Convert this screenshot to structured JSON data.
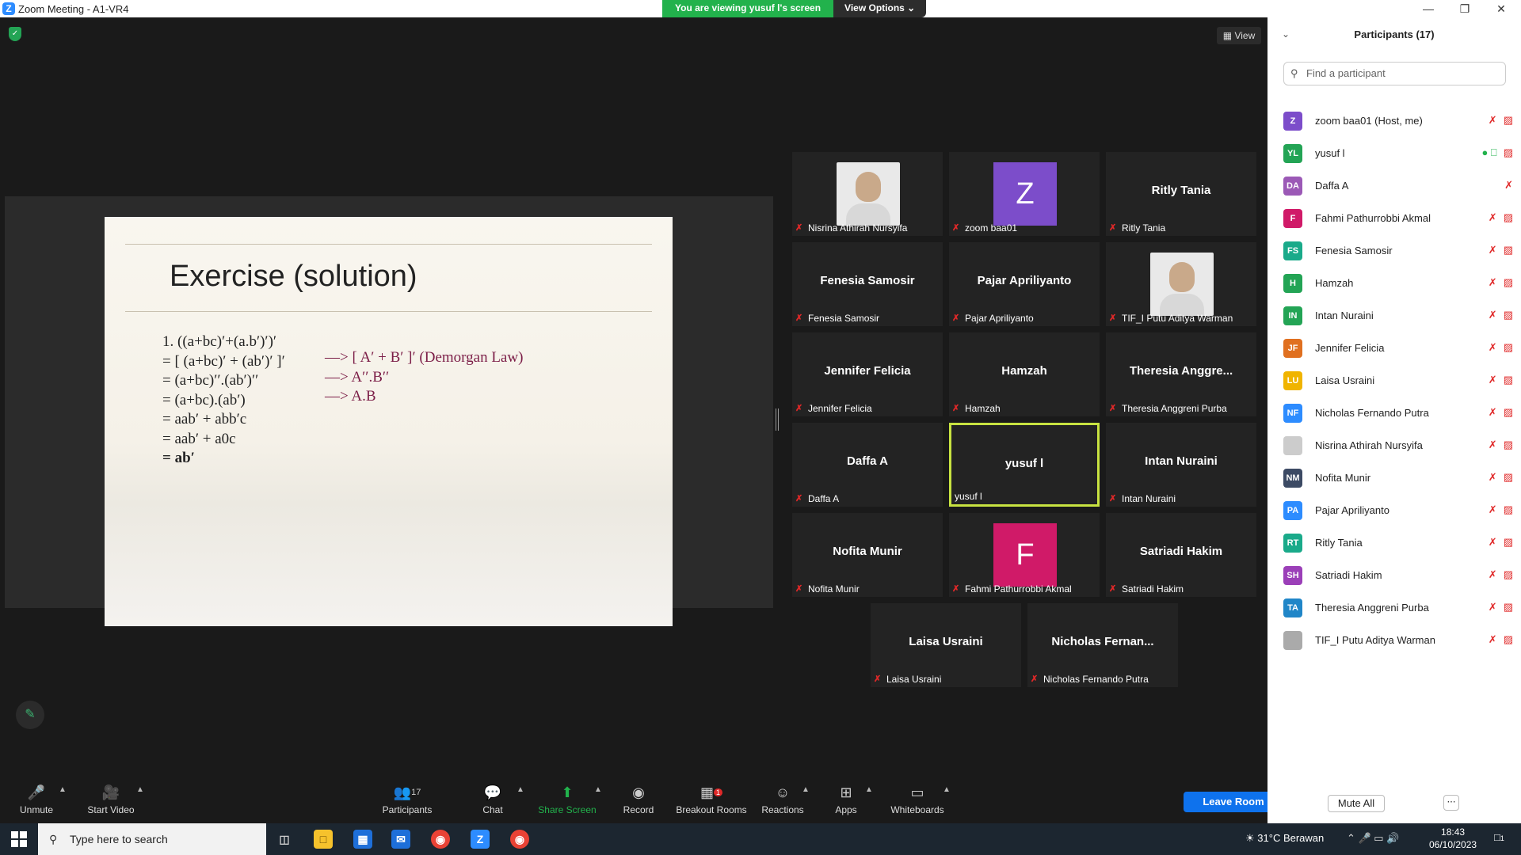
{
  "window": {
    "title": "Zoom Meeting - A1-VR4"
  },
  "banner": {
    "message": "You are viewing yusuf l's screen",
    "options_label": "View Options"
  },
  "view_button": "View",
  "slide": {
    "heading": "Exercise (solution)",
    "left_lines": [
      "1.  ((a+bc)′+(a.b′)′)′",
      "= [ (a+bc)′ + (ab′)′ ]′",
      "= (a+bc)′′.(ab′)′′",
      "= (a+bc).(ab′)",
      "= aab′ + abb′c",
      "= aab′ + a0c",
      "= ab′"
    ],
    "right_lines": [
      "—> [ A′ + B′ ]′   (Demorgan Law)",
      "—> A′′.B′′",
      "—> A.B"
    ]
  },
  "tiles": [
    {
      "big": "",
      "name": "Nisrina Athirah Nursyifa"
    },
    {
      "big": "Z",
      "name": "zoom baa01",
      "color": "#7c4dca"
    },
    {
      "big": "Ritly Tania",
      "name": "Ritly Tania"
    },
    {
      "big": "Fenesia Samosir",
      "name": "Fenesia Samosir"
    },
    {
      "big": "Pajar Apriliyanto",
      "name": "Pajar Apriliyanto"
    },
    {
      "big": "",
      "name": "TIF_I Putu Aditya Warman"
    },
    {
      "big": "Jennifer Felicia",
      "name": "Jennifer Felicia"
    },
    {
      "big": "Hamzah",
      "name": "Hamzah"
    },
    {
      "big": "Theresia  Anggre...",
      "name": "Theresia Anggreni Purba"
    },
    {
      "big": "Daffa A",
      "name": "Daffa A"
    },
    {
      "big": "yusuf l",
      "name": "yusuf l"
    },
    {
      "big": "Intan Nuraini",
      "name": "Intan Nuraini"
    },
    {
      "big": "Nofita Munir",
      "name": "Nofita Munir"
    },
    {
      "big": "F",
      "name": "Fahmi Pathurrobbi Akmal",
      "color": "#d01a68"
    },
    {
      "big": "Satriadi Hakim",
      "name": "Satriadi Hakim"
    },
    {
      "big": "Laisa Usraini",
      "name": "Laisa Usraini"
    },
    {
      "big": "Nicholas  Fernan...",
      "name": "Nicholas Fernando Putra"
    }
  ],
  "toolbar": {
    "unmute": "Unmute",
    "start_video": "Start Video",
    "participants": "Participants",
    "participants_count": "17",
    "chat": "Chat",
    "share_screen": "Share Screen",
    "record": "Record",
    "breakout_rooms": "Breakout Rooms",
    "breakout_badge": "1",
    "reactions": "Reactions",
    "apps": "Apps",
    "whiteboards": "Whiteboards",
    "leave": "Leave Room"
  },
  "panel": {
    "title": "Participants (17)",
    "search_placeholder": "Find a participant",
    "mute_all": "Mute All",
    "participants": [
      {
        "initials": "Z",
        "name": "zoom baa01 (Host, me)",
        "color": "#7c4dca"
      },
      {
        "initials": "YL",
        "name": "yusuf l",
        "color": "#23a455"
      },
      {
        "initials": "DA",
        "name": "Daffa A",
        "color": "#9b59b6"
      },
      {
        "initials": "F",
        "name": "Fahmi Pathurrobbi Akmal",
        "color": "#d01a68"
      },
      {
        "initials": "FS",
        "name": "Fenesia Samosir",
        "color": "#1aaa8a"
      },
      {
        "initials": "H",
        "name": "Hamzah",
        "color": "#23a455"
      },
      {
        "initials": "IN",
        "name": "Intan Nuraini",
        "color": "#23a455"
      },
      {
        "initials": "JF",
        "name": "Jennifer Felicia",
        "color": "#e07020"
      },
      {
        "initials": "LU",
        "name": "Laisa Usraini",
        "color": "#f0b400"
      },
      {
        "initials": "NF",
        "name": "Nicholas Fernando Putra",
        "color": "#2d8cff"
      },
      {
        "initials": "",
        "name": "Nisrina Athirah Nursyifa",
        "color": "#cccccc"
      },
      {
        "initials": "NM",
        "name": "Nofita Munir",
        "color": "#3c4a64"
      },
      {
        "initials": "PA",
        "name": "Pajar Apriliyanto",
        "color": "#2d8cff"
      },
      {
        "initials": "RT",
        "name": "Ritly Tania",
        "color": "#1aaa8a"
      },
      {
        "initials": "SH",
        "name": "Satriadi Hakim",
        "color": "#9b3fb8"
      },
      {
        "initials": "TA",
        "name": "Theresia Anggreni Purba",
        "color": "#2086c8"
      },
      {
        "initials": "",
        "name": "TIF_I Putu Aditya Warman",
        "color": "#aaaaaa"
      }
    ]
  },
  "taskbar": {
    "search_placeholder": "Type here to search",
    "weather": "31°C  Berawan",
    "time": "18:43",
    "date": "06/10/2023",
    "notif_count": "1"
  }
}
